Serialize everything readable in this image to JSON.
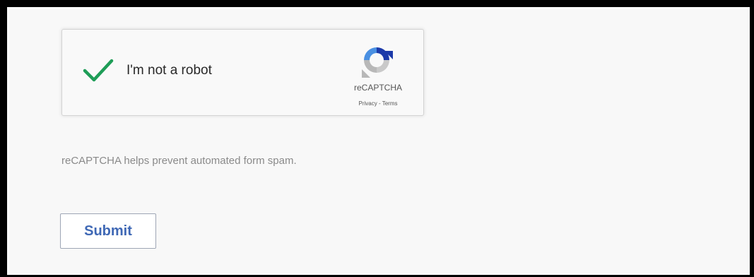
{
  "recaptcha": {
    "checkbox_label": "I'm not a robot",
    "checked": true,
    "brand": "reCAPTCHA",
    "privacy_link": "Privacy",
    "separator": " - ",
    "terms_link": "Terms",
    "logo_icon": "recaptcha-logo-icon",
    "check_icon": "checkmark-icon",
    "colors": {
      "check": "#1e9d57",
      "logo_blue": "#1c3aa9",
      "logo_light_blue": "#4a90e2",
      "logo_gray": "#b8b8b8"
    }
  },
  "form": {
    "helper_text": "reCAPTCHA helps prevent automated form spam.",
    "submit_label": "Submit",
    "accent_color": "#3f68b5"
  }
}
